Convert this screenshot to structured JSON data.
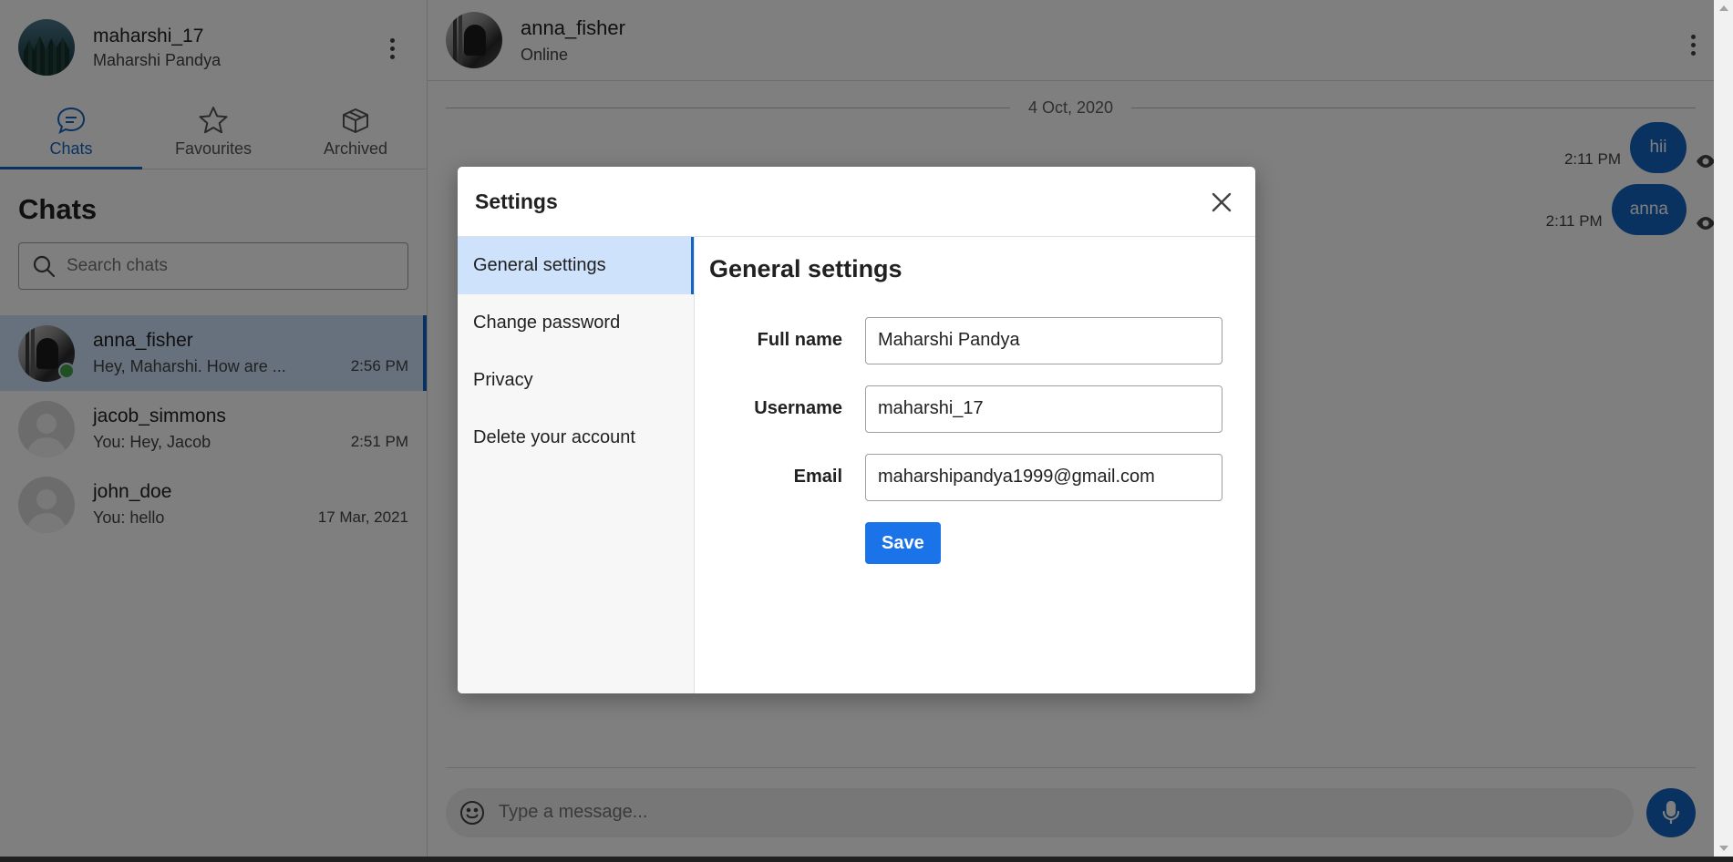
{
  "profile": {
    "username": "maharshi_17",
    "full_name": "Maharshi Pandya",
    "avatar_icon": "forest-photo-avatar",
    "menu_icon": "kebab-menu-icon"
  },
  "tabs": [
    {
      "label": "Chats",
      "icon": "chat-bubble-icon",
      "active": true
    },
    {
      "label": "Favourites",
      "icon": "star-icon",
      "active": false
    },
    {
      "label": "Archived",
      "icon": "archive-box-icon",
      "active": false
    }
  ],
  "sidebar": {
    "title": "Chats",
    "search_placeholder": "Search chats"
  },
  "chats": [
    {
      "name": "anna_fisher",
      "preview": "Hey, Maharshi. How are ...",
      "time": "2:56 PM",
      "active": true,
      "online": true
    },
    {
      "name": "jacob_simmons",
      "preview": "You: Hey, Jacob",
      "time": "2:51 PM",
      "active": false,
      "online": false
    },
    {
      "name": "john_doe",
      "preview": "You: hello",
      "time": "17 Mar, 2021",
      "active": false,
      "online": false
    }
  ],
  "conversation": {
    "name": "anna_fisher",
    "status": "Online",
    "date": "4 Oct, 2020",
    "messages": [
      {
        "text": "hii",
        "time": "2:11 PM"
      },
      {
        "text": "anna",
        "time": "2:11 PM"
      }
    ],
    "composer_placeholder": "Type a message..."
  },
  "settings": {
    "title": "Settings",
    "nav": [
      {
        "label": "General settings",
        "active": true
      },
      {
        "label": "Change password",
        "active": false
      },
      {
        "label": "Privacy",
        "active": false
      },
      {
        "label": "Delete your account",
        "active": false
      }
    ],
    "section_title": "General settings",
    "fields": {
      "full_name": {
        "label": "Full name",
        "value": "Maharshi Pandya"
      },
      "username": {
        "label": "Username",
        "value": "maharshi_17"
      },
      "email": {
        "label": "Email",
        "value": "maharshipandya1999@gmail.com"
      }
    },
    "save_label": "Save"
  },
  "colors": {
    "accent": "#1565c0",
    "active_bg": "#cfe2fb",
    "save_button": "#1a73e8",
    "online": "#43a047"
  }
}
